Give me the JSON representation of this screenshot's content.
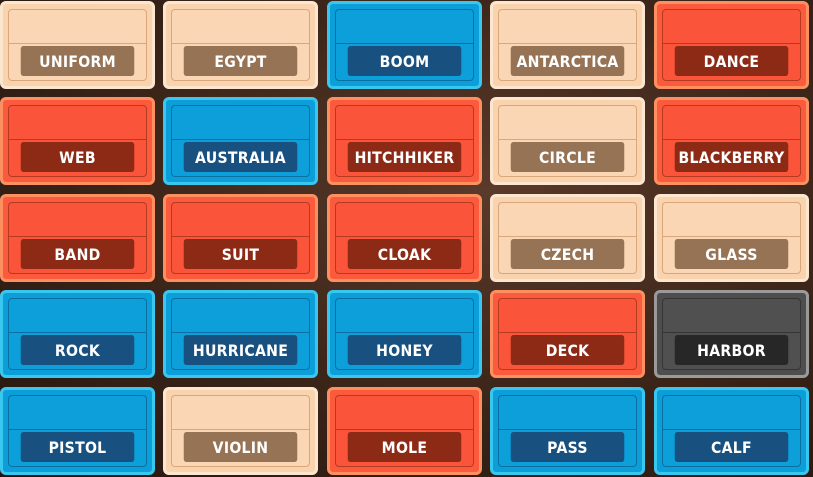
{
  "board": {
    "rows": [
      [
        {
          "word": "UNIFORM",
          "team": "neutral"
        },
        {
          "word": "EGYPT",
          "team": "neutral"
        },
        {
          "word": "BOOM",
          "team": "blue"
        },
        {
          "word": "ANTARCTICA",
          "team": "neutral"
        },
        {
          "word": "DANCE",
          "team": "red"
        }
      ],
      [
        {
          "word": "WEB",
          "team": "red"
        },
        {
          "word": "AUSTRALIA",
          "team": "blue"
        },
        {
          "word": "HITCHHIKER",
          "team": "red"
        },
        {
          "word": "CIRCLE",
          "team": "neutral"
        },
        {
          "word": "BLACKBERRY",
          "team": "red"
        }
      ],
      [
        {
          "word": "BAND",
          "team": "red"
        },
        {
          "word": "SUIT",
          "team": "red"
        },
        {
          "word": "CLOAK",
          "team": "red"
        },
        {
          "word": "CZECH",
          "team": "neutral"
        },
        {
          "word": "GLASS",
          "team": "neutral"
        }
      ],
      [
        {
          "word": "ROCK",
          "team": "blue"
        },
        {
          "word": "HURRICANE",
          "team": "blue"
        },
        {
          "word": "HONEY",
          "team": "blue"
        },
        {
          "word": "DECK",
          "team": "red"
        },
        {
          "word": "HARBOR",
          "team": "assassin"
        }
      ],
      [
        {
          "word": "PISTOL",
          "team": "blue"
        },
        {
          "word": "VIOLIN",
          "team": "neutral"
        },
        {
          "word": "MOLE",
          "team": "red"
        },
        {
          "word": "PASS",
          "team": "blue"
        },
        {
          "word": "CALF",
          "team": "blue"
        }
      ]
    ]
  },
  "colors": {
    "red_team": "#fb5a3c",
    "blue_team": "#0b9ed9",
    "neutral": "#f9d2ae",
    "assassin": "#4e4e4e"
  }
}
